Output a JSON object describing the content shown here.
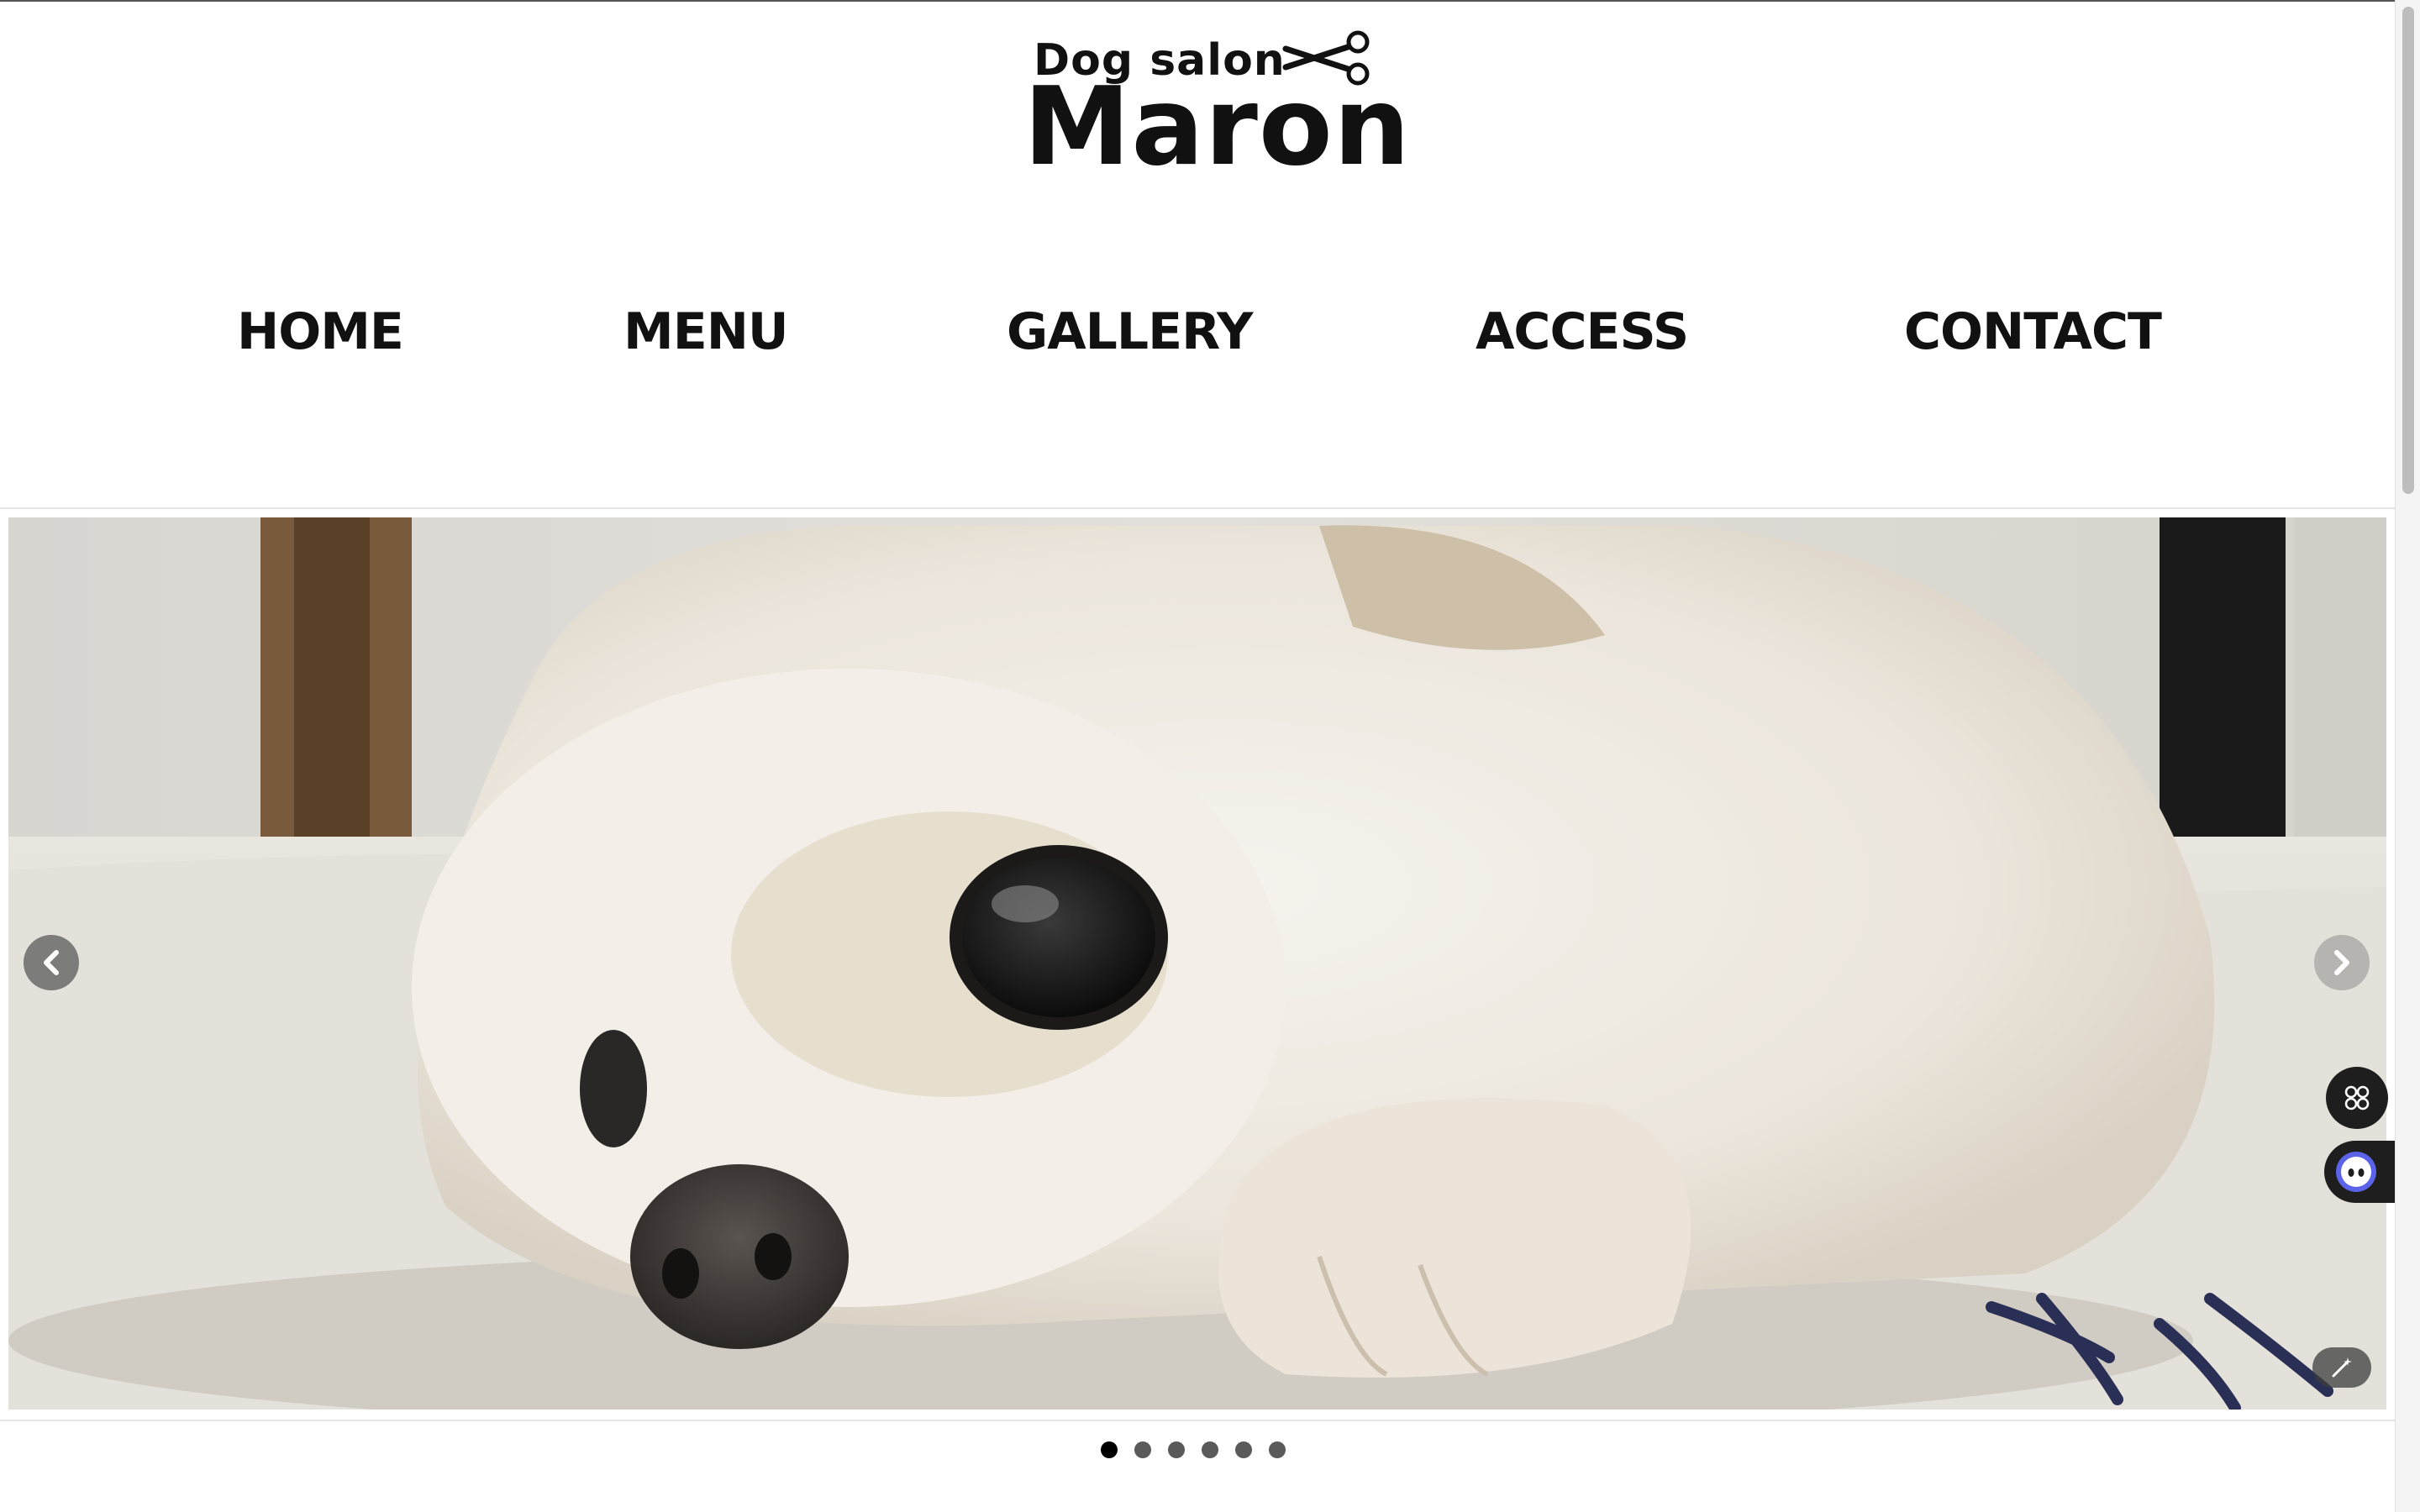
{
  "logo": {
    "small_text": "Dog salon",
    "big_text": "Maron",
    "icon": "scissors-icon"
  },
  "nav": {
    "items": [
      {
        "label": "HOME"
      },
      {
        "label": "MENU"
      },
      {
        "label": "GALLERY"
      },
      {
        "label": "ACCESS"
      },
      {
        "label": "CONTACT"
      }
    ]
  },
  "slider": {
    "image": "white-chihuahua-lying-photo",
    "prev_icon": "chevron-left-icon",
    "next_icon": "chevron-right-icon",
    "edit_icon": "magic-wand-icon",
    "slide_count": 6,
    "active_index": 0
  },
  "widgets": {
    "grid_icon": "command-grid-icon",
    "assistant_icon": "robot-face-icon"
  }
}
